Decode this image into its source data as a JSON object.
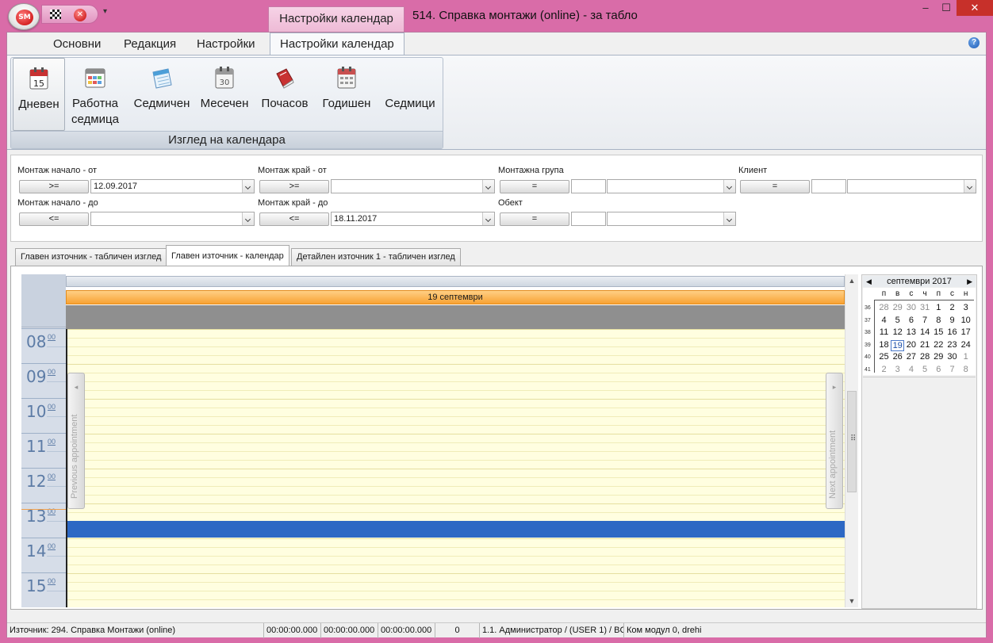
{
  "titlebar": {
    "orb_text": "SM",
    "context_tab": "Настройки календар",
    "window_title": "514. Справка монтажи (online) - за табло",
    "qat_more": "▾"
  },
  "ribbon": {
    "tabs": [
      "Основни",
      "Редакция",
      "Настройки",
      "Настройки календар"
    ],
    "buttons": [
      {
        "label1": "Дневен",
        "label2": ""
      },
      {
        "label1": "Работна",
        "label2": "седмица"
      },
      {
        "label1": "Седмичен",
        "label2": ""
      },
      {
        "label1": "Месечен",
        "label2": ""
      },
      {
        "label1": "Почасов",
        "label2": ""
      },
      {
        "label1": "Годишен",
        "label2": ""
      },
      {
        "label1": "Седмици",
        "label2": ""
      }
    ],
    "group_caption": "Изглед на календара",
    "help": "?"
  },
  "filters": {
    "montage_start_from": {
      "label": "Монтаж начало - от",
      "op": ">=",
      "value": "12.09.2017"
    },
    "montage_start_to": {
      "label": "Монтаж начало - до",
      "op": "<=",
      "value": ""
    },
    "montage_end_from": {
      "label": "Монтаж край - от",
      "op": ">=",
      "value": ""
    },
    "montage_end_to": {
      "label": "Монтаж край - до",
      "op": "<=",
      "value": "18.11.2017"
    },
    "montage_group": {
      "label": "Монтажна група",
      "op": "="
    },
    "object": {
      "label": "Обект",
      "op": "="
    },
    "client": {
      "label": "Клиент",
      "op": "="
    }
  },
  "subtabs": [
    "Главен източник - табличен изглед",
    "Главен източник - календар",
    "Детайлен източник 1 - табличен изглед"
  ],
  "scheduler": {
    "date_header": "19 септември",
    "hours": [
      {
        "h": "08",
        "m": "00"
      },
      {
        "h": "09",
        "m": "00"
      },
      {
        "h": "10",
        "m": "00"
      },
      {
        "h": "11",
        "m": "00"
      },
      {
        "h": "12",
        "m": "00"
      },
      {
        "h": "13",
        "m": "00"
      },
      {
        "h": "14",
        "m": "00"
      },
      {
        "h": "15",
        "m": "00"
      }
    ],
    "prev_appointment": "Previous appointment",
    "next_appointment": "Next appointment",
    "appointment_color": "#2d68c4"
  },
  "date_navigator": {
    "month_title": "септември 2017",
    "dow": [
      "п",
      "в",
      "с",
      "ч",
      "п",
      "с",
      "н"
    ],
    "weeks": [
      {
        "wk": "36",
        "days": [
          {
            "d": "28",
            "o": true
          },
          {
            "d": "29",
            "o": true
          },
          {
            "d": "30",
            "o": true
          },
          {
            "d": "31",
            "o": true
          },
          {
            "d": "1"
          },
          {
            "d": "2"
          },
          {
            "d": "3"
          }
        ]
      },
      {
        "wk": "37",
        "days": [
          {
            "d": "4"
          },
          {
            "d": "5"
          },
          {
            "d": "6"
          },
          {
            "d": "7"
          },
          {
            "d": "8"
          },
          {
            "d": "9"
          },
          {
            "d": "10"
          }
        ]
      },
      {
        "wk": "38",
        "days": [
          {
            "d": "11"
          },
          {
            "d": "12"
          },
          {
            "d": "13"
          },
          {
            "d": "14"
          },
          {
            "d": "15"
          },
          {
            "d": "16"
          },
          {
            "d": "17"
          }
        ]
      },
      {
        "wk": "39",
        "days": [
          {
            "d": "18"
          },
          {
            "d": "19",
            "t": true
          },
          {
            "d": "20"
          },
          {
            "d": "21"
          },
          {
            "d": "22"
          },
          {
            "d": "23"
          },
          {
            "d": "24"
          }
        ]
      },
      {
        "wk": "40",
        "days": [
          {
            "d": "25"
          },
          {
            "d": "26"
          },
          {
            "d": "27"
          },
          {
            "d": "28"
          },
          {
            "d": "29"
          },
          {
            "d": "30"
          },
          {
            "d": "1",
            "o": true
          }
        ]
      },
      {
        "wk": "41",
        "days": [
          {
            "d": "2",
            "o": true
          },
          {
            "d": "3",
            "o": true
          },
          {
            "d": "4",
            "o": true
          },
          {
            "d": "5",
            "o": true
          },
          {
            "d": "6",
            "o": true
          },
          {
            "d": "7",
            "o": true
          },
          {
            "d": "8",
            "o": true
          }
        ]
      }
    ]
  },
  "statusbar": {
    "source": "Източник: 294. Справка Монтажи (online)",
    "t1": "00:00:00.000",
    "t2": "00:00:00.000",
    "t3": "00:00:00.000",
    "count": "0",
    "user": "1.1. Администратор /  (USER 1) / BC",
    "module": "Ком модул 0, drehi"
  }
}
